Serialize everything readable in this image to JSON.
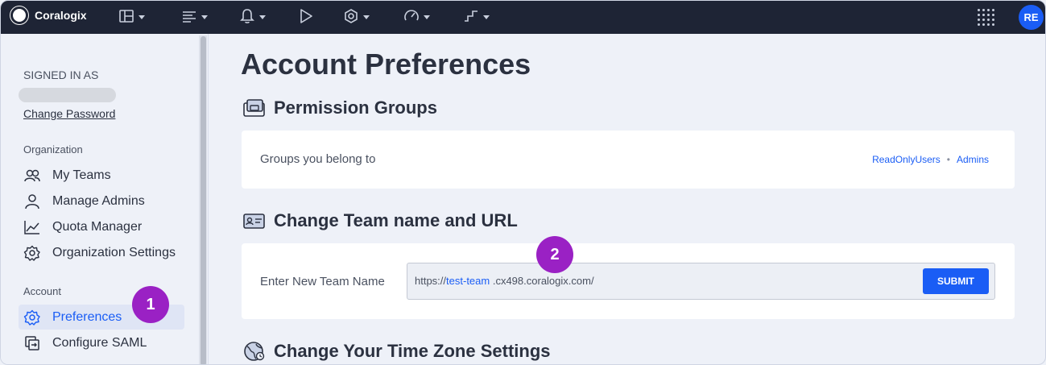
{
  "topbar": {
    "brand": "Coralogix",
    "avatar_initials": "RE",
    "nav_icons": [
      "dashboard-icon",
      "logs-icon",
      "alerts-icon",
      "play-icon",
      "integrations-icon",
      "metrics-icon",
      "flow-icon"
    ]
  },
  "sidebar": {
    "signed_in_label": "SIGNED IN AS",
    "change_password": "Change Password",
    "org_section": "Organization",
    "org_items": [
      {
        "label": "My Teams",
        "icon": "teams-icon"
      },
      {
        "label": "Manage Admins",
        "icon": "user-icon"
      },
      {
        "label": "Quota Manager",
        "icon": "chart-icon"
      },
      {
        "label": "Organization Settings",
        "icon": "gear-icon"
      }
    ],
    "account_section": "Account",
    "account_items": [
      {
        "label": "Preferences",
        "icon": "gear-icon",
        "active": true
      },
      {
        "label": "Configure SAML",
        "icon": "saml-icon"
      }
    ]
  },
  "markers": {
    "one": "1",
    "two": "2"
  },
  "main": {
    "title": "Account Preferences",
    "permission_groups": {
      "heading": "Permission Groups",
      "label": "Groups you belong to",
      "groups": [
        "ReadOnlyUsers",
        "Admins"
      ],
      "separator": "•"
    },
    "team_name": {
      "heading": "Change Team name and URL",
      "label": "Enter New Team Name",
      "url_prefix": "https://",
      "url_team": "test-team",
      "url_suffix": ".cx498.coralogix.com/",
      "submit": "SUBMIT"
    },
    "timezone": {
      "heading": "Change Your Time Zone Settings"
    }
  },
  "colors": {
    "accent": "#1a5df5",
    "topbar": "#1e2435",
    "marker": "#9a21c4",
    "background": "#eef1f8"
  }
}
